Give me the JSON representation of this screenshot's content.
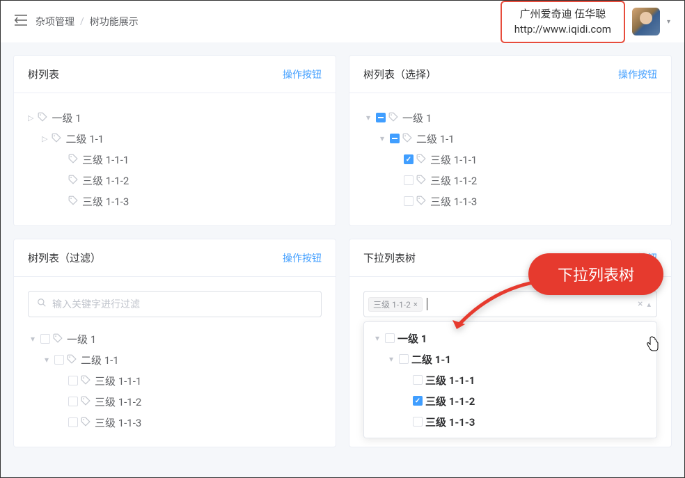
{
  "header": {
    "breadcrumb": [
      "杂项管理",
      "树功能展示"
    ],
    "author_line1": "广州爱奇迪 伍华聪",
    "author_line2": "http://www.iqidi.com"
  },
  "cards": {
    "tree_list": {
      "title": "树列表",
      "action": "操作按钮",
      "nodes": {
        "l1": "一级 1",
        "l2": "二级 1-1",
        "l3a": "三级 1-1-1",
        "l3b": "三级 1-1-2",
        "l3c": "三级 1-1-3"
      }
    },
    "tree_select": {
      "title": "树列表（选择）",
      "action": "操作按钮",
      "nodes": {
        "l1": "一级 1",
        "l2": "二级 1-1",
        "l3a": "三级 1-1-1",
        "l3b": "三级 1-1-2",
        "l3c": "三级 1-1-3"
      }
    },
    "tree_filter": {
      "title": "树列表（过滤）",
      "action": "操作按钮",
      "placeholder": "输入关键字进行过滤",
      "nodes": {
        "l1": "一级 1",
        "l2": "二级 1-1",
        "l3a": "三级 1-1-1",
        "l3b": "三级 1-1-2",
        "l3c": "三级 1-1-3"
      }
    },
    "tree_dropdown": {
      "title": "下拉列表树",
      "action": "操作按钮",
      "selected_tag": "三级 1-1-2",
      "nodes": {
        "l1": "一级 1",
        "l2": "二级 1-1",
        "l3a": "三级 1-1-1",
        "l3b": "三级 1-1-2",
        "l3c": "三级 1-1-3"
      }
    }
  },
  "callout": "下拉列表树"
}
